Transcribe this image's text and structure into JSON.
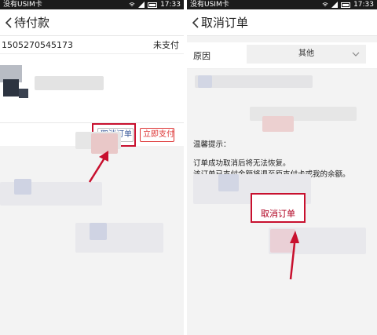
{
  "left": {
    "status": {
      "carrier": "没有USIM卡",
      "time": "17:33"
    },
    "title": "待付款",
    "order": {
      "number": "15052705451​73",
      "status": "未支付"
    },
    "buttons": {
      "cancel": "取消订单",
      "pay": "立即支付"
    }
  },
  "right": {
    "status": {
      "carrier": "没有USIM卡",
      "time": "17:33"
    },
    "title": "取消订单",
    "reason": {
      "label": "原因",
      "value": "其他"
    },
    "tips": {
      "title": "温馨提示：",
      "line1": "订单成功取消后将无法恢复。",
      "line2": "该订单已支付金额将退至原支付卡或我的余额。"
    },
    "confirm": "取消订单"
  },
  "colors": {
    "highlight": "#c8102e",
    "background": "#f3f3f3"
  }
}
